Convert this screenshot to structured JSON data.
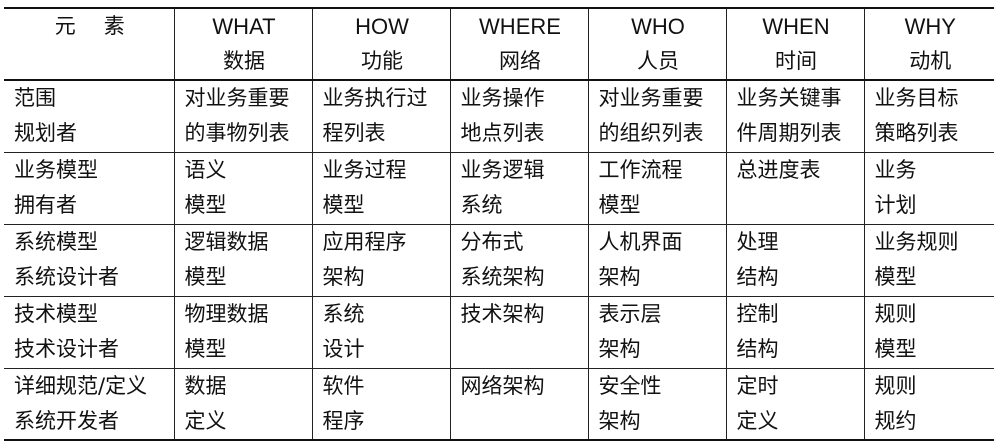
{
  "corner_label": "元素",
  "columns": [
    {
      "en": "WHAT",
      "zh": "数据"
    },
    {
      "en": "HOW",
      "zh": "功能"
    },
    {
      "en": "WHERE",
      "zh": "网络"
    },
    {
      "en": "WHO",
      "zh": "人员"
    },
    {
      "en": "WHEN",
      "zh": "时间"
    },
    {
      "en": "WHY",
      "zh": "动机"
    }
  ],
  "rows": [
    {
      "header": [
        "范围",
        "规划者"
      ],
      "cells": [
        [
          "对业务重要",
          "的事物列表"
        ],
        [
          "业务执行过",
          "程列表"
        ],
        [
          "业务操作",
          "地点列表"
        ],
        [
          "对业务重要",
          "的组织列表"
        ],
        [
          "业务关键事",
          "件周期列表"
        ],
        [
          "业务目标",
          "策略列表"
        ]
      ]
    },
    {
      "header": [
        "业务模型",
        "拥有者"
      ],
      "cells": [
        [
          "语义",
          "模型"
        ],
        [
          "业务过程",
          "模型"
        ],
        [
          "业务逻辑",
          "系统"
        ],
        [
          "工作流程",
          "模型"
        ],
        [
          "总进度表"
        ],
        [
          "业务",
          "计划"
        ]
      ]
    },
    {
      "header": [
        "系统模型",
        "系统设计者"
      ],
      "cells": [
        [
          "逻辑数据",
          "模型"
        ],
        [
          "应用程序",
          "架构"
        ],
        [
          "分布式",
          "系统架构"
        ],
        [
          "人机界面",
          "架构"
        ],
        [
          "处理",
          "结构"
        ],
        [
          "业务规则",
          "模型"
        ]
      ]
    },
    {
      "header": [
        "技术模型",
        "技术设计者"
      ],
      "cells": [
        [
          "物理数据",
          "模型"
        ],
        [
          "系统",
          "设计"
        ],
        [
          "技术架构"
        ],
        [
          "表示层",
          "架构"
        ],
        [
          "控制",
          "结构"
        ],
        [
          "规则",
          "模型"
        ]
      ]
    },
    {
      "header": [
        "详细规范/定义",
        "系统开发者"
      ],
      "cells": [
        [
          "数据",
          "定义"
        ],
        [
          "软件",
          "程序"
        ],
        [
          "网络架构"
        ],
        [
          "安全性",
          "架构"
        ],
        [
          "定时",
          "定义"
        ],
        [
          "规则",
          "规约"
        ]
      ]
    }
  ]
}
